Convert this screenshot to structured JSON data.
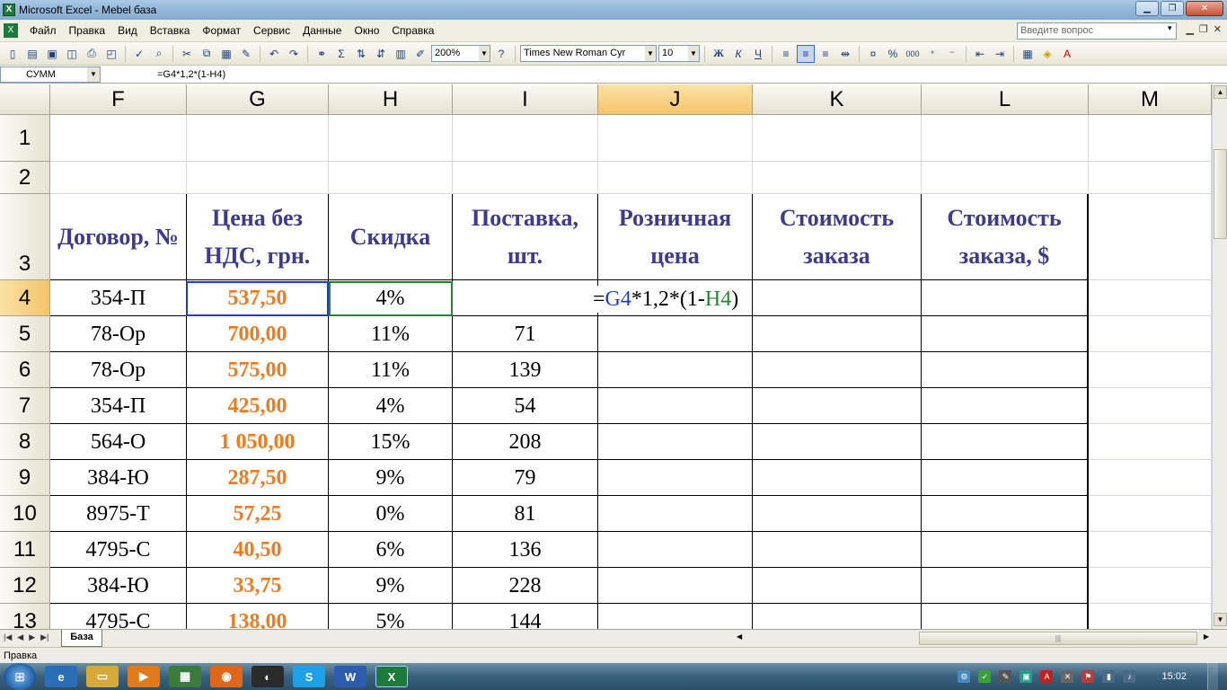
{
  "window": {
    "title": "Microsoft Excel - Mebel база"
  },
  "menu": {
    "items": [
      {
        "label": "Файл"
      },
      {
        "label": "Правка"
      },
      {
        "label": "Вид"
      },
      {
        "label": "Вставка"
      },
      {
        "label": "Формат"
      },
      {
        "label": "Сервис"
      },
      {
        "label": "Данные"
      },
      {
        "label": "Окно"
      },
      {
        "label": "Справка"
      }
    ],
    "help_placeholder": "Введите вопрос"
  },
  "toolbar": {
    "zoom": "200%",
    "font_name": "Times New Roman Cyr",
    "font_size": "10",
    "bold_label": "Ж",
    "italic_label": "К",
    "underline_label": "Ч",
    "percent_label": "%",
    "thousands_label": "000",
    "sum_label": "Σ"
  },
  "formula_bar": {
    "name_box": "СУММ",
    "formula": "=G4*1,2*(1-H4)"
  },
  "grid": {
    "columns": [
      "F",
      "G",
      "H",
      "I",
      "J",
      "K",
      "L",
      "M"
    ],
    "active_column": "J",
    "rows": [
      "1",
      "2",
      "3",
      "4",
      "5",
      "6",
      "7",
      "8",
      "9",
      "10",
      "11",
      "12",
      "13"
    ],
    "active_row": "4",
    "headers": {
      "contract": "Договор, №",
      "price": "Цена без НДС, грн.",
      "discount": "Скидка",
      "supply": "Поставка, шт.",
      "retail": "Розничная цена",
      "order_cost": "Стоимость заказа",
      "order_cost_usd": "Стоимость заказа, $"
    },
    "data": [
      {
        "contract": "354-П",
        "price": "537,50",
        "discount": "4%",
        "supply": ""
      },
      {
        "contract": "78-Ор",
        "price": "700,00",
        "discount": "11%",
        "supply": "71"
      },
      {
        "contract": "78-Ор",
        "price": "575,00",
        "discount": "11%",
        "supply": "139"
      },
      {
        "contract": "354-П",
        "price": "425,00",
        "discount": "4%",
        "supply": "54"
      },
      {
        "contract": "564-О",
        "price": "1 050,00",
        "discount": "15%",
        "supply": "208"
      },
      {
        "contract": "384-Ю",
        "price": "287,50",
        "discount": "9%",
        "supply": "79"
      },
      {
        "contract": "8975-Т",
        "price": "57,25",
        "discount": "0%",
        "supply": "81"
      },
      {
        "contract": "4795-С",
        "price": "40,50",
        "discount": "6%",
        "supply": "136"
      },
      {
        "contract": "384-Ю",
        "price": "33,75",
        "discount": "9%",
        "supply": "228"
      },
      {
        "contract": "4795-С",
        "price": "138,00",
        "discount": "5%",
        "supply": "144"
      }
    ],
    "edit_formula": {
      "prefix": "=",
      "ref_g": "G4",
      "mid": "*1,2*(1-",
      "ref_h": "H4",
      "suffix": ")"
    }
  },
  "sheets": {
    "tabs": [
      {
        "label": "База"
      }
    ]
  },
  "status": {
    "mode": "Правка"
  },
  "taskbar": {
    "clock": "15:02"
  },
  "colors": {
    "header_text": "#3e3b8f",
    "price_text": "#f27a1c",
    "ref_g": "#1f3bd6",
    "ref_h": "#1c8a2c",
    "active_header": "#f5c46a"
  }
}
